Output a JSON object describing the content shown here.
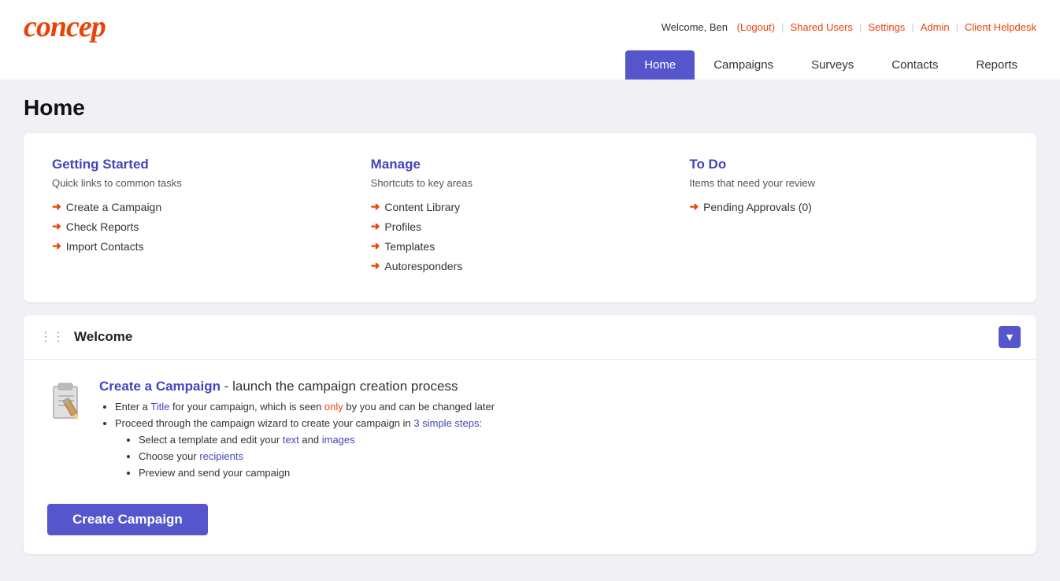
{
  "logo": {
    "text": "concep"
  },
  "header": {
    "welcome": "Welcome, Ben",
    "logout": "(Logout)",
    "separator1": "|",
    "shared_users": "Shared Users",
    "separator2": "|",
    "settings": "Settings",
    "separator3": "|",
    "admin": "Admin",
    "separator4": "|",
    "client_helpdesk": "Client Helpdesk"
  },
  "nav": {
    "items": [
      {
        "label": "Home",
        "active": true
      },
      {
        "label": "Campaigns",
        "active": false
      },
      {
        "label": "Surveys",
        "active": false
      },
      {
        "label": "Contacts",
        "active": false
      },
      {
        "label": "Reports",
        "active": false
      }
    ]
  },
  "page_title": "Home",
  "getting_started": {
    "title": "Getting Started",
    "subtitle": "Quick links to common tasks",
    "links": [
      {
        "label": "Create a Campaign"
      },
      {
        "label": "Check Reports"
      },
      {
        "label": "Import Contacts"
      }
    ]
  },
  "manage": {
    "title": "Manage",
    "subtitle": "Shortcuts to key areas",
    "links": [
      {
        "label": "Content Library"
      },
      {
        "label": "Profiles"
      },
      {
        "label": "Templates"
      },
      {
        "label": "Autoresponders"
      }
    ]
  },
  "todo": {
    "title": "To Do",
    "subtitle": "Items that need your review",
    "links": [
      {
        "label": "Pending Approvals (0)"
      }
    ]
  },
  "welcome_widget": {
    "header": "Welcome",
    "collapse_icon": "▼",
    "drag_icon": "⋮⋮",
    "campaign_link": "Create a Campaign",
    "campaign_desc": " - launch the campaign creation process",
    "bullet1": "Enter a Title for your campaign, which is seen only by you and can be changed later",
    "bullet1_highlight": "Title",
    "bullet1_highlight2": "only",
    "bullet2": "Proceed through the campaign wizard to create your campaign in 3 simple steps:",
    "bullet2_highlight": "3 simple steps:",
    "step1": "Select a template and edit your text and images",
    "step2": "Choose your recipients",
    "step3": "Preview and send your campaign",
    "create_btn": "Create Campaign"
  }
}
